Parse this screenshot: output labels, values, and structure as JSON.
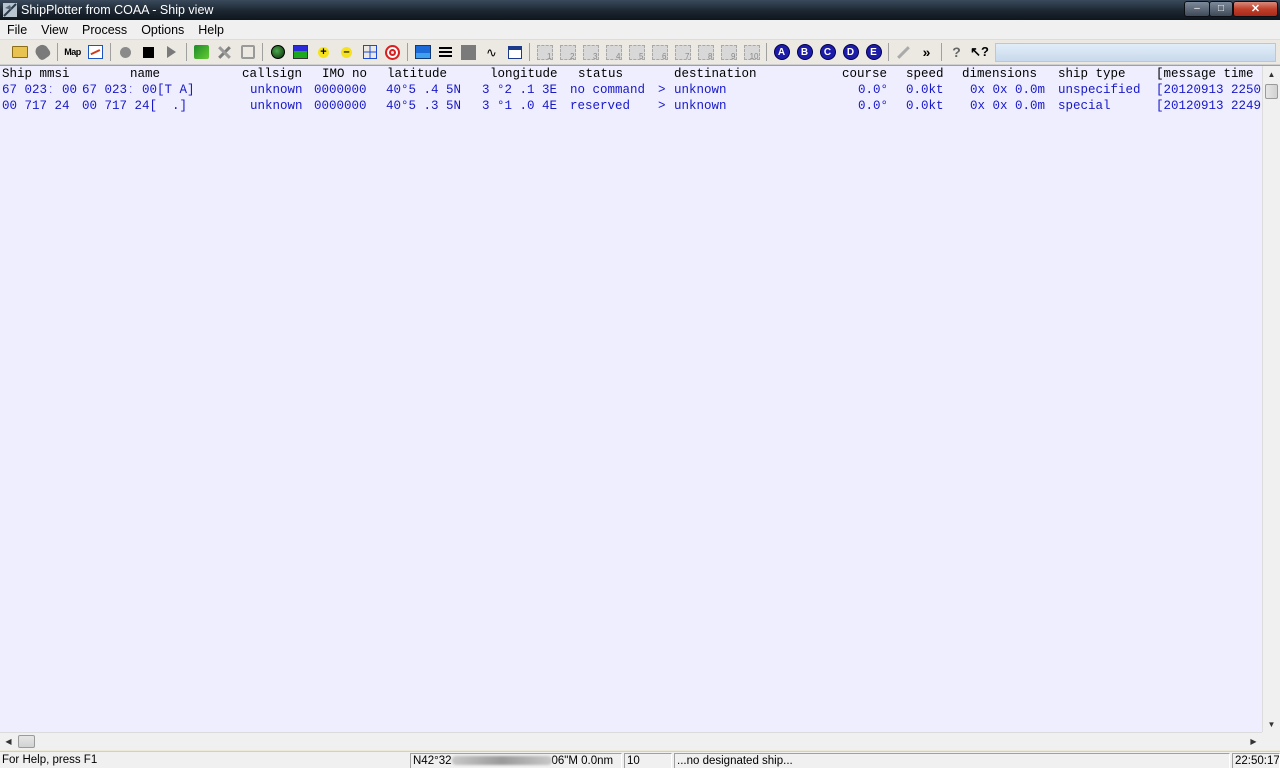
{
  "window": {
    "title": "ShipPlotter from COAA - Ship view",
    "minimize_glyph": "–",
    "maximize_glyph": "□",
    "close_glyph": "✕"
  },
  "menu": [
    "File",
    "View",
    "Process",
    "Options",
    "Help"
  ],
  "toolbar": {
    "map_label": "Map",
    "plus_glyph": "+",
    "minus_glyph": "–",
    "wave_glyph": "∿",
    "ghost_labels": [
      "1",
      "2",
      "3",
      "4",
      "5",
      "6",
      "7",
      "8",
      "9",
      "10"
    ],
    "letters": [
      "A",
      "B",
      "C",
      "D",
      "E"
    ],
    "chevrons_glyph": "»",
    "help_glyph": "?",
    "whatsthis_glyph": "↖?"
  },
  "table": {
    "columns": [
      "Ship mmsi",
      "name",
      "callsign",
      "IMO no",
      "latitude",
      "longitude",
      "status",
      "destination",
      "course",
      "speed",
      "dimensions",
      "ship type",
      "[message time"
    ],
    "rows": [
      {
        "mmsi": "67 023ː 00",
        "name": "67 023ː 00[T A]",
        "callsign": "unknown",
        "imo": "0000000",
        "latitude": "40°5 .4 5N",
        "longitude": "3 °2 .1 3E",
        "status": "no command",
        "dest_marker": ">",
        "destination": "unknown",
        "course": "0.0°",
        "speed": "0.0kt",
        "dimensions": "0x 0x 0.0m",
        "ship_type": "unspecified",
        "message_time": "[20120913 2250"
      },
      {
        "mmsi": "00 717 24",
        "name": "00 717 24[  .]",
        "callsign": "unknown",
        "imo": "0000000",
        "latitude": "40°5 .3 5N",
        "longitude": "3 °1 .0 4E",
        "status": "reserved",
        "dest_marker": ">",
        "destination": "unknown",
        "course": "0.0°",
        "speed": "0.0kt",
        "dimensions": "0x 0x 0.0m",
        "ship_type": "special",
        "message_time": "[20120913 2249"
      }
    ]
  },
  "scrollbars": {
    "up": "▲",
    "down": "▼",
    "left": "◀",
    "right": "▶"
  },
  "status": {
    "help": "For Help, press F1",
    "position_start": "N42°32",
    "position_end": "06\"M 0.0nm",
    "count": "10",
    "designated_ship": "...no designated ship...",
    "time": "22:50:17"
  },
  "colors": {
    "row_text": "#1818c8",
    "view_background": "#eeeefe"
  }
}
